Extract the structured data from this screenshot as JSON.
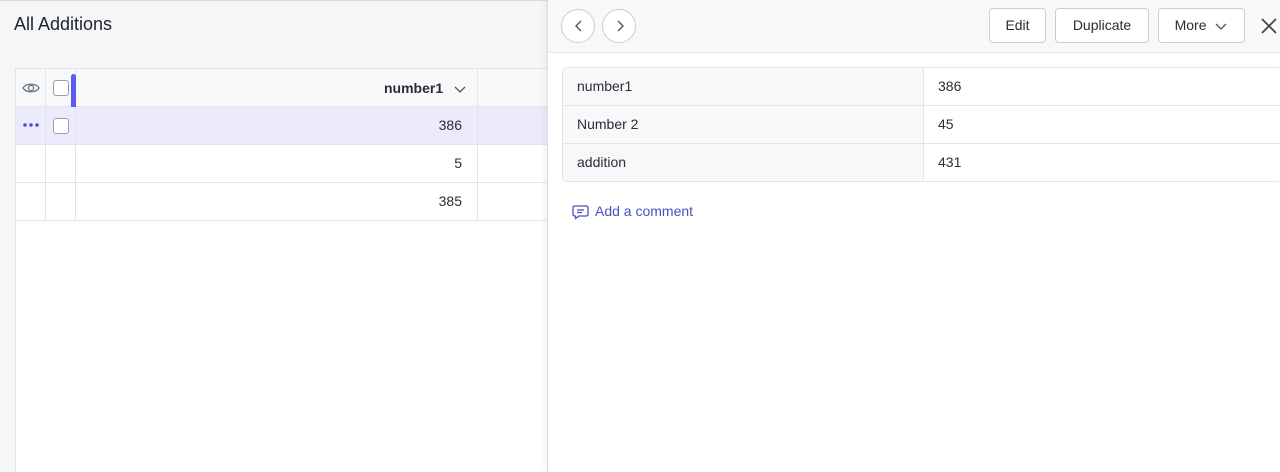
{
  "list": {
    "title": "All Additions",
    "column_header": "number1",
    "rows": [
      {
        "value": "386",
        "selected": true
      },
      {
        "value": "5",
        "selected": false
      },
      {
        "value": "385",
        "selected": false
      }
    ]
  },
  "panel": {
    "buttons": {
      "edit": "Edit",
      "duplicate": "Duplicate",
      "more": "More"
    },
    "fields": [
      {
        "label": "number1",
        "value": "386"
      },
      {
        "label": "Number 2",
        "value": "45"
      },
      {
        "label": "addition",
        "value": "431"
      }
    ],
    "add_comment": "Add a comment"
  },
  "icons": {
    "visibility": "eye-icon",
    "row_menu": "more-dots-icon",
    "sort": "chevron-down-icon",
    "prev": "chevron-left-icon",
    "next": "chevron-right-icon",
    "close": "close-icon",
    "comment": "comment-icon"
  },
  "colors": {
    "accent": "#4b4fe3",
    "selected_row": "#ebebfc",
    "link": "#4b4fbf"
  }
}
